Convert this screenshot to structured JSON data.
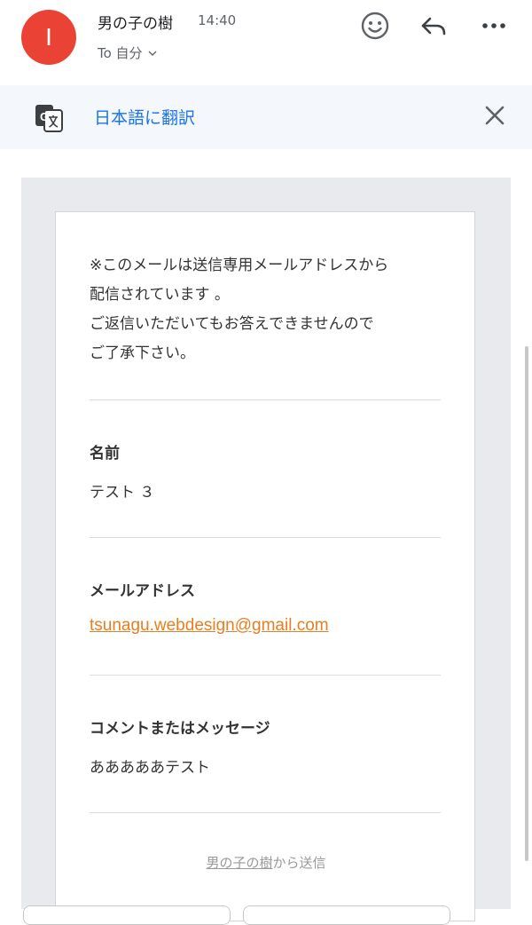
{
  "header": {
    "avatar_letter": "I",
    "sender": "男の子の樹",
    "time": "14:40",
    "recipient": "To 自分",
    "icons": [
      "emoji-icon",
      "reply-icon",
      "more-icon"
    ]
  },
  "translate": {
    "label": "日本語に翻訳",
    "icons": [
      "translate-icon",
      "close-icon"
    ]
  },
  "message": {
    "notice_lines": [
      "※このメールは送信専用メールアドレスから",
      "配信されています 。",
      "ご返信いただいてもお答えできませんので",
      "ご了承下さい。"
    ],
    "fields": [
      {
        "label": "名前",
        "value": "テスト ３"
      },
      {
        "label": "メールアドレス",
        "value": "tsunagu.webdesign@gmail.com"
      },
      {
        "label": "コメントまたはメッセージ",
        "value": "あああああテスト"
      }
    ],
    "footer": {
      "site_name": "男の子の樹",
      "suffix": "から送信"
    }
  },
  "colors": {
    "avatar": "#ea4335",
    "link_blue": "#1a73e8",
    "email_link": "#e67e22"
  }
}
